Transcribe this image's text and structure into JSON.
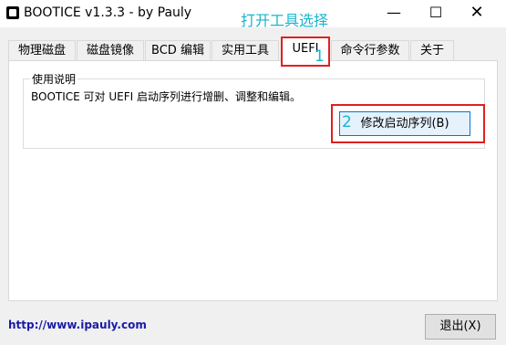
{
  "window": {
    "title": "BOOTICE v1.3.3 - by Pauly",
    "minimize_glyph": "—",
    "maximize_glyph": "☐",
    "close_glyph": "✕"
  },
  "annotations": {
    "top_text": "打开工具选择",
    "step1": "1",
    "step2": "2",
    "color": "#19b4cf",
    "highlight_color": "#e02020"
  },
  "tabs": [
    {
      "label": "物理磁盘"
    },
    {
      "label": "磁盘镜像"
    },
    {
      "label": "BCD 编辑"
    },
    {
      "label": "实用工具"
    },
    {
      "label": "UEFI"
    },
    {
      "label": "命令行参数"
    },
    {
      "label": "关于"
    }
  ],
  "active_tab": "UEFI",
  "usage": {
    "group_label": "使用说明",
    "description": "BOOTICE 可对 UEFI 启动序列进行增删、调整和编辑。",
    "edit_button": "修改启动序列(B)"
  },
  "footer": {
    "link": "http://www.ipauly.com",
    "exit_button": "退出(X)"
  }
}
